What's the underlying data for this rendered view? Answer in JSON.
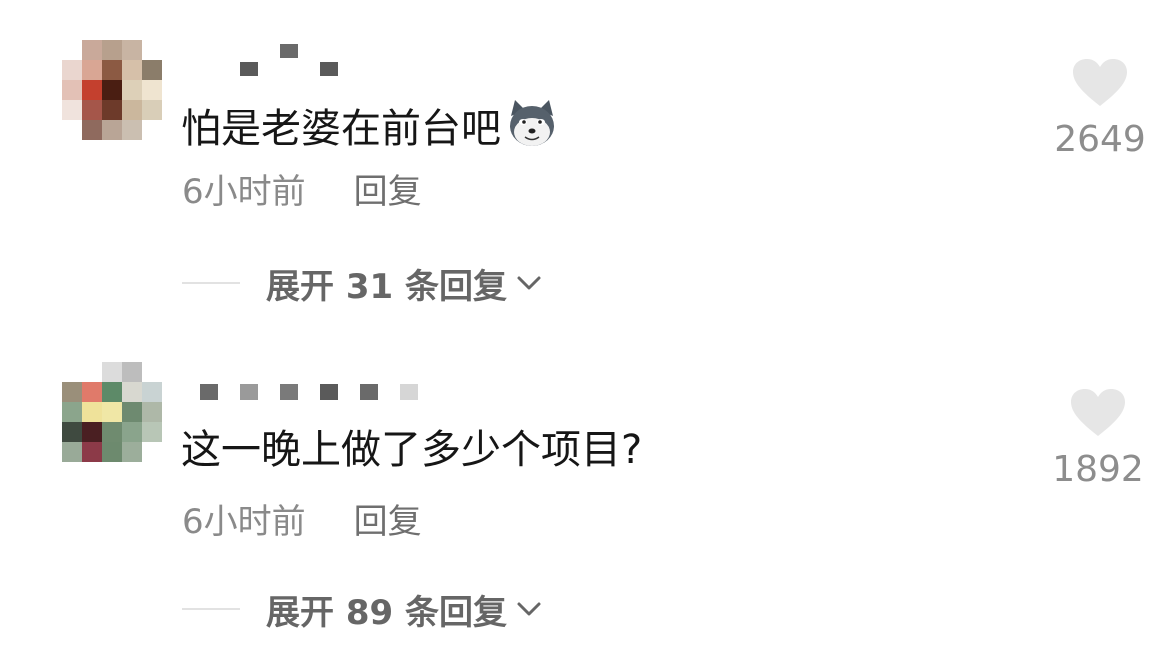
{
  "comments": [
    {
      "text": "怕是老婆在前台吧",
      "emoji_icon": "doge-emoji",
      "time": "6小时前",
      "reply_label": "回复",
      "expand_label": "展开 31 条回复",
      "like_count": "2649"
    },
    {
      "text": "这一晚上做了多少个项目?",
      "time": "6小时前",
      "reply_label": "回复",
      "expand_label": "展开 89 条回复",
      "like_count": "1892"
    }
  ],
  "colors": {
    "text": "#161616",
    "meta": "#8a8a8a",
    "heart": "#e6e6e6",
    "expand": "#666666"
  }
}
